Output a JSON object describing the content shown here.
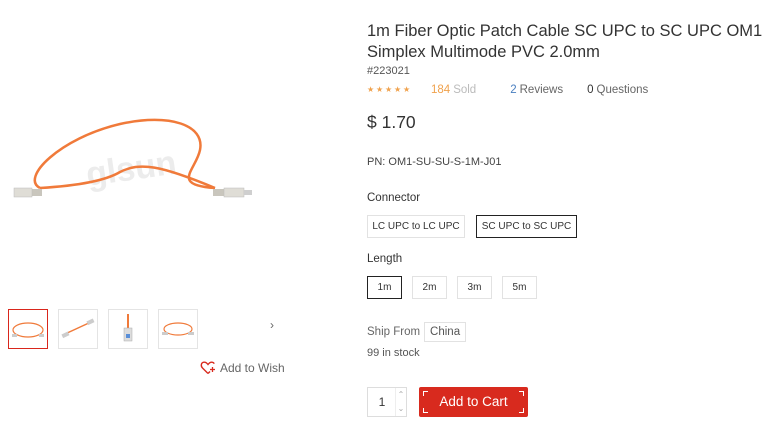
{
  "product": {
    "title": "1m Fiber Optic Patch Cable SC UPC to SC UPC OM1 Simplex Multimode PVC 2.0mm",
    "sku": "#223021",
    "rating_stars": 5,
    "sold_count": "184",
    "sold_label": "Sold",
    "reviews_count": "2",
    "reviews_label": "Reviews",
    "questions_count": "0",
    "questions_label": "Questions",
    "price": "$ 1.70",
    "pn": "PN: OM1-SU-SU-S-1M-J01",
    "watermark": "glsun"
  },
  "connector": {
    "label": "Connector",
    "options": [
      "LC UPC to LC UPC",
      "SC UPC to SC UPC"
    ],
    "selected": "SC UPC to SC UPC"
  },
  "length": {
    "label": "Length",
    "options": [
      "1m",
      "2m",
      "3m",
      "5m"
    ],
    "selected": "1m"
  },
  "shipping": {
    "label": "Ship From",
    "origin": "China",
    "stock": "99 in stock"
  },
  "cart": {
    "quantity": "1",
    "add_label": "Add to Cart"
  },
  "gallery": {
    "next_icon": "chevron-right-icon",
    "thumbnail_count": 4
  },
  "wish": {
    "label": "Add to Wish",
    "icon": "heart-plus-icon"
  },
  "colors": {
    "accent": "#d82a1e",
    "cable": "#f07a3a",
    "star": "#f0a24d",
    "link": "#4a7fc0"
  }
}
